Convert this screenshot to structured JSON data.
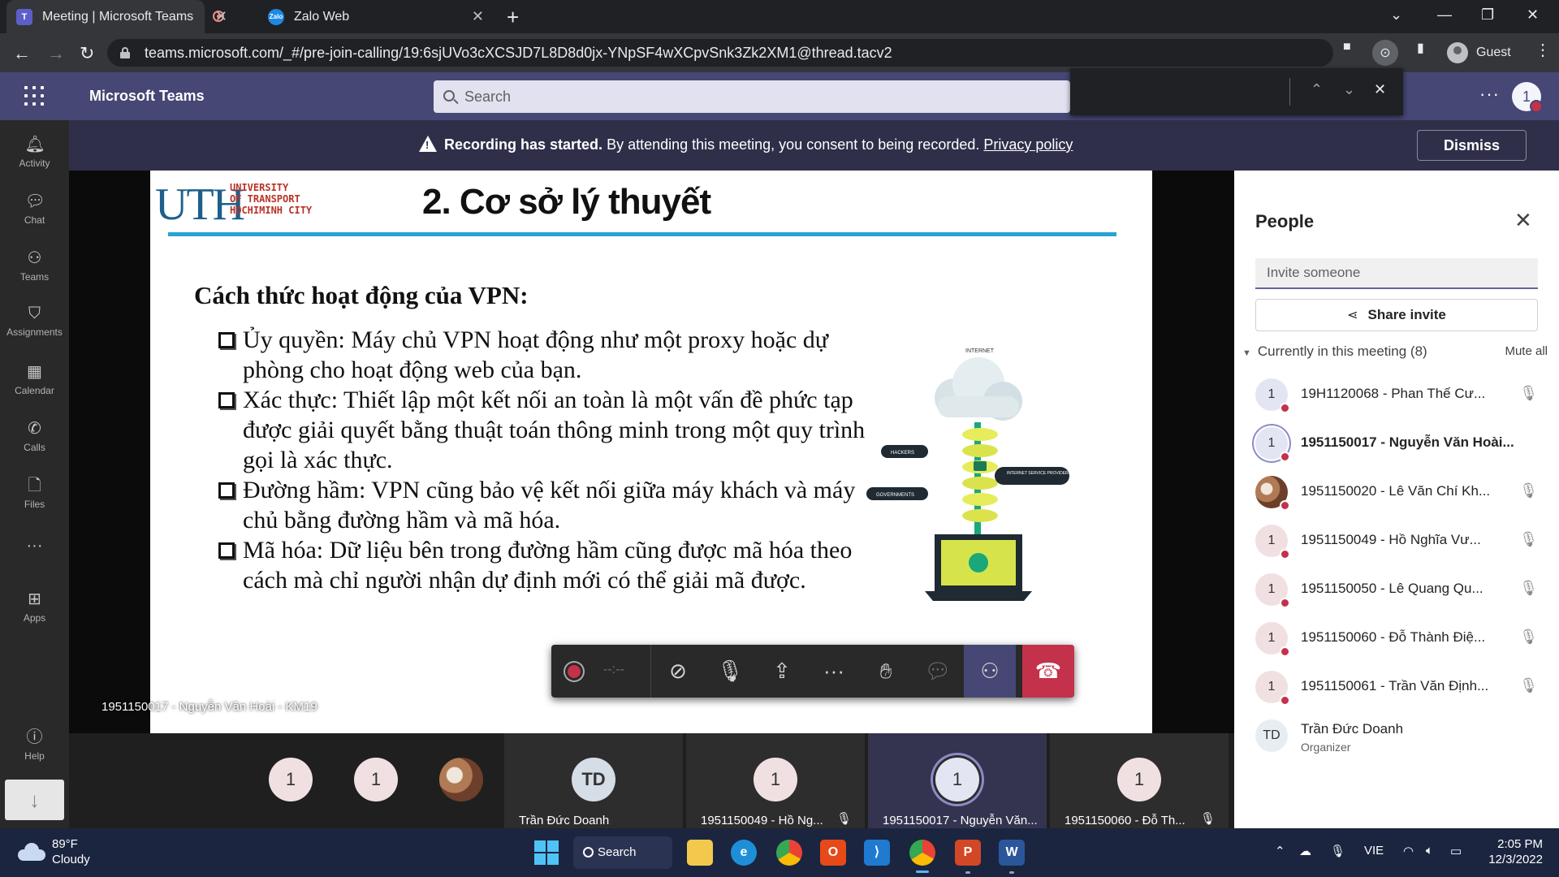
{
  "browser": {
    "tabs": [
      {
        "title": "Meeting | Microsoft Teams",
        "favicon": "teams-icon"
      },
      {
        "title": "Zalo Web",
        "favicon": "zalo-icon"
      }
    ],
    "url": "teams.microsoft.com/_#/pre-join-calling/19:6sjUVo3cXCSJD7L8D8d0jx-YNpSF4wXCpvSnk3Zk2XM1@thread.tacv2",
    "profile": "Guest"
  },
  "teams": {
    "app_title": "Microsoft Teams",
    "search_placeholder": "Search",
    "user_initial": "1"
  },
  "rail": [
    {
      "label": "Activity",
      "icon": "bell-icon"
    },
    {
      "label": "Chat",
      "icon": "chat-icon"
    },
    {
      "label": "Teams",
      "icon": "teams-icon"
    },
    {
      "label": "Assignments",
      "icon": "assignments-icon"
    },
    {
      "label": "Calendar",
      "icon": "calendar-icon"
    },
    {
      "label": "Calls",
      "icon": "phone-icon"
    },
    {
      "label": "Files",
      "icon": "file-icon"
    },
    {
      "label": "Apps",
      "icon": "apps-icon"
    },
    {
      "label": "Help",
      "icon": "help-icon"
    }
  ],
  "banner": {
    "bold": "Recording has started.",
    "text": "By attending this meeting, you consent to being recorded.",
    "link": "Privacy policy",
    "dismiss": "Dismiss"
  },
  "slide": {
    "logo_letters": "UTH",
    "logo_lines": [
      "UNIVERSITY",
      "OF TRANSPORT",
      "HOCHIMINH CITY"
    ],
    "title": "2. Cơ sở lý thuyết",
    "heading": "Cách thức hoạt động của VPN:",
    "bullets": [
      "Ủy quyền: Máy chủ VPN hoạt động như một proxy hoặc dự phòng cho hoạt động web của bạn.",
      "Xác thực: Thiết lập một kết nối an toàn là một vấn đề phức tạp được giải quyết bằng thuật toán thông minh trong một quy trình gọi là xác thực.",
      "Đường hầm: VPN cũng bảo vệ kết nối giữa máy khách và máy chủ bằng đường hầm và mã hóa.",
      "Mã hóa: Dữ liệu bên trong đường hầm cũng được mã hóa theo cách mà chỉ người nhận dự định mới có thể giải mã được."
    ],
    "diagram_labels": {
      "internet": "INTERNET",
      "hackers": "HACKERS",
      "isp": "INTERNET SERVICE PROVIDERS",
      "governments": "GOVERNMENTS"
    }
  },
  "presenter_label": "1951150017 - Nguyễn Văn Hoài - KM19",
  "call_toolbar": {
    "timer": "--:--"
  },
  "gallery": [
    {
      "initials": "1"
    },
    {
      "initials": "1"
    },
    {
      "initials": ""
    },
    {
      "initials": "TD",
      "name": "Trần Đức Doanh"
    },
    {
      "initials": "1",
      "name": "1951150049 - Hồ Ng..."
    },
    {
      "initials": "1",
      "name": "1951150017 - Nguyễn Văn..."
    },
    {
      "initials": "1",
      "name": "1951150060 - Đỗ Th..."
    }
  ],
  "people": {
    "title": "People",
    "invite_placeholder": "Invite someone",
    "share_invite": "Share invite",
    "section": "Currently in this meeting (8)",
    "mute_all": "Mute all",
    "list": [
      {
        "initials": "1",
        "name": "19H1120068 - Phan Thế Cư..."
      },
      {
        "initials": "1",
        "name": "1951150017 - Nguyễn Văn Hoài..."
      },
      {
        "initials": "",
        "name": "1951150020 - Lê Văn Chí Kh..."
      },
      {
        "initials": "1",
        "name": "1951150049 - Hồ Nghĩa Vư..."
      },
      {
        "initials": "1",
        "name": "1951150050 - Lê Quang Qu..."
      },
      {
        "initials": "1",
        "name": "1951150060 - Đỗ Thành Điệ..."
      },
      {
        "initials": "1",
        "name": "1951150061 - Trần Văn Định..."
      },
      {
        "initials": "TD",
        "name": "Trần Đức Doanh",
        "role": "Organizer"
      }
    ]
  },
  "taskbar": {
    "temp": "89°F",
    "weather": "Cloudy",
    "search": "Search",
    "lang": "VIE",
    "time": "2:05 PM",
    "date": "12/3/2022"
  },
  "colors": {
    "teams_purple": "#464775",
    "banner": "#2f2f4a",
    "hangup_red": "#c4314b",
    "slide_rule": "#27a3d6"
  }
}
